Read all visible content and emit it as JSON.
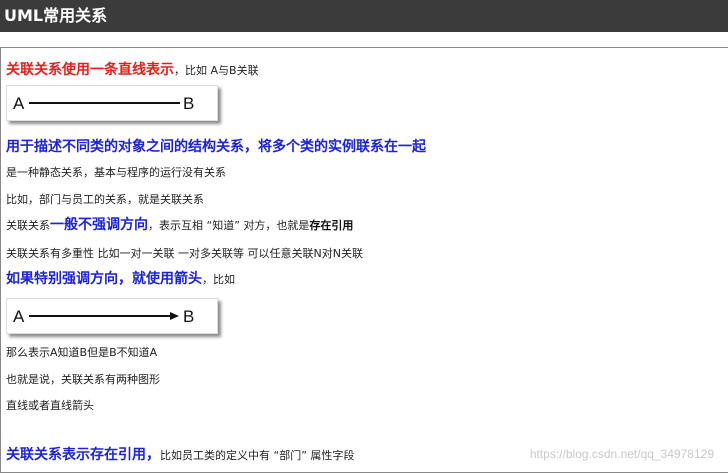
{
  "header": {
    "title": "UML常用关系"
  },
  "lines": {
    "l1_red": "关联关系使用一条直线表示",
    "l1_rest": "，比如  A与B关联",
    "heading2": "用于描述不同类的对象之间的结构关系，将多个类的实例联系在一起",
    "l3": "是一种静态关系，基本与程序的运行没有关系",
    "l4": "比如，部门与员工的关系，就是关联关系",
    "l5_pre": "关联关系",
    "l5_blue": "一般不强调方向",
    "l5_mid": "，表示互相 “知道” 对方，也就是",
    "l5_bold": "存在引用",
    "l6": "关联关系有多重性 比如一对一关联 一对多关联等 可以任意关联N对N关联",
    "l7_blue": "如果特别强调方向，就使用箭头",
    "l7_rest": "，比如",
    "l8": "那么表示A知道B但是B不知道A",
    "l9": "也就是说，关联关系有两种图形",
    "l10": "直线或者直线箭头",
    "l11_blue": "关联关系表示存在引用，",
    "l11_rest": "比如员工类的定义中有 “部门” 属性字段"
  },
  "diagram1": {
    "left": "A",
    "right": "B",
    "arrow": false
  },
  "diagram2": {
    "left": "A",
    "right": "B",
    "arrow": true
  },
  "watermark": "https://blog.csdn.net/qq_34978129",
  "colors": {
    "header_bg": "#3b3b3b",
    "red": "#e2211c",
    "blue": "#1c23d9"
  }
}
